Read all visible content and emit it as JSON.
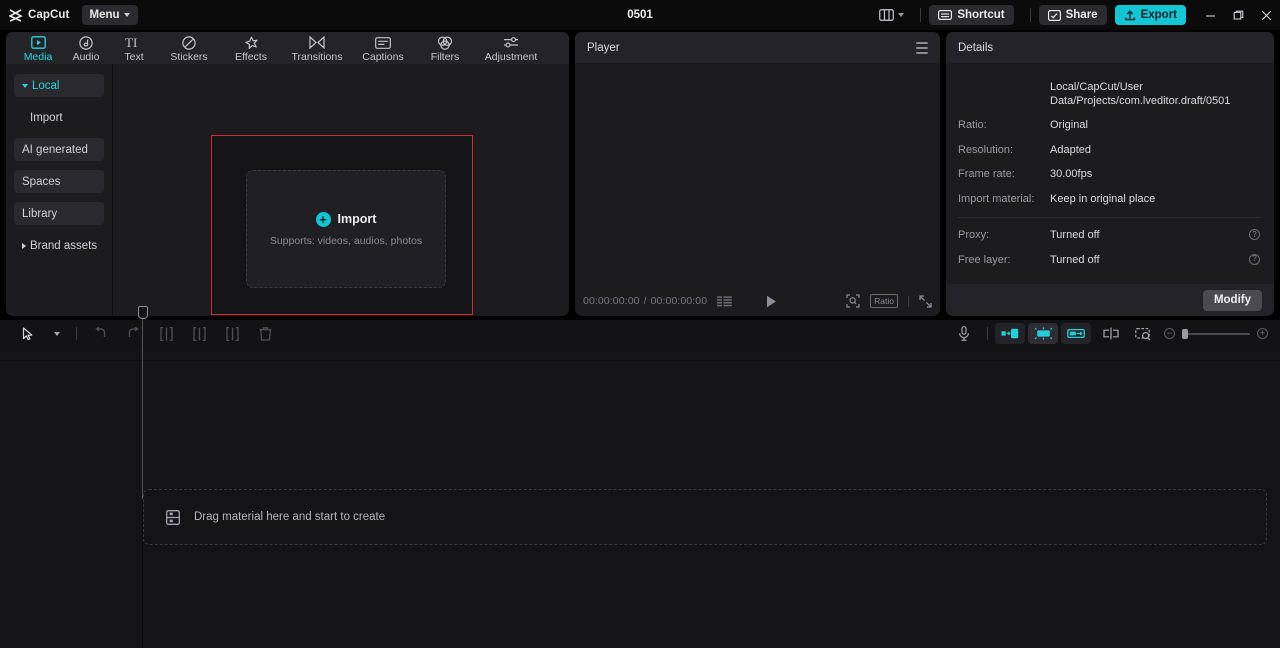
{
  "app": {
    "brand": "CapCut",
    "brand_icon": "capcut-logo-icon",
    "menu_label": "Menu",
    "project_title": "0501"
  },
  "titlebar": {
    "layout_icon": "layout-panels-icon",
    "layout_chevron_icon": "chevron-down-icon",
    "shortcut_label": "Shortcut",
    "shortcut_icon": "keyboard-icon",
    "share_label": "Share",
    "share_icon": "share-screen-icon",
    "export_label": "Export",
    "export_icon": "upload-icon",
    "minimize_icon": "minimize-icon",
    "maximize_icon": "maximize-icon",
    "close_icon": "close-icon",
    "accent_color": "#14c6d4"
  },
  "tabs": [
    {
      "label": "Media",
      "icon": "media-play-frame-icon",
      "active": true
    },
    {
      "label": "Audio",
      "icon": "audio-note-icon",
      "active": false
    },
    {
      "label": "Text",
      "icon": "text-ti-icon",
      "active": false
    },
    {
      "label": "Stickers",
      "icon": "sticker-circle-icon",
      "active": false
    },
    {
      "label": "Effects",
      "icon": "effects-sparkle-icon",
      "active": false
    },
    {
      "label": "Transitions",
      "icon": "transitions-bowtie-icon",
      "active": false
    },
    {
      "label": "Captions",
      "icon": "captions-box-icon",
      "active": false
    },
    {
      "label": "Filters",
      "icon": "filters-rings-icon",
      "active": false
    },
    {
      "label": "Adjustment",
      "icon": "adjustment-sliders-icon",
      "active": false
    }
  ],
  "sidebar": {
    "items": [
      {
        "label": "Local",
        "state": "active-expanded",
        "chevron": "chevron-down-icon"
      },
      {
        "label": "Import",
        "state": "sub",
        "chevron": ""
      },
      {
        "label": "AI generated",
        "state": "boxed",
        "chevron": ""
      },
      {
        "label": "Spaces",
        "state": "boxed",
        "chevron": ""
      },
      {
        "label": "Library",
        "state": "boxed",
        "chevron": ""
      },
      {
        "label": "Brand assets",
        "state": "collapsed",
        "chevron": "chevron-right-icon"
      }
    ]
  },
  "import_zone": {
    "plus_icon": "plus-circle-icon",
    "title": "Import",
    "subtitle": "Supports: videos, audios, photos",
    "highlight_color": "#d22d2d"
  },
  "player": {
    "title": "Player",
    "menu_icon": "hamburger-menu-icon",
    "current_time": "00:00:00:00",
    "separator": "/",
    "total_time": "00:00:00:00",
    "list_icon": "playlist-icon",
    "play_icon": "play-icon",
    "magnify_icon": "magnify-frame-icon",
    "ratio_label": "Ratio",
    "fullscreen_icon": "fullscreen-icon"
  },
  "details": {
    "title": "Details",
    "path_value": "Local/CapCut/User Data/Projects/com.lveditor.draft/0501",
    "rows": [
      {
        "label": "Ratio:",
        "value": "Original"
      },
      {
        "label": "Resolution:",
        "value": "Adapted"
      },
      {
        "label": "Frame rate:",
        "value": "30.00fps"
      },
      {
        "label": "Import material:",
        "value": "Keep in original place"
      }
    ],
    "rows_secondary": [
      {
        "label": "Proxy:",
        "value": "Turned off",
        "help_icon": "help-circle-icon",
        "help_glyph": "?"
      },
      {
        "label": "Free layer:",
        "value": "Turned off",
        "help_icon": "help-circle-icon",
        "help_glyph": "?"
      }
    ],
    "modify_label": "Modify"
  },
  "timeline": {
    "tools_left": [
      {
        "name": "select-tool",
        "icon": "cursor-arrow-icon"
      },
      {
        "name": "tool-dropdown",
        "icon": "chevron-down-icon"
      },
      {
        "name": "undo",
        "icon": "undo-icon"
      },
      {
        "name": "redo",
        "icon": "redo-icon"
      },
      {
        "name": "split",
        "icon": "split-clip-icon"
      },
      {
        "name": "trim-left",
        "icon": "trim-left-icon"
      },
      {
        "name": "trim-right",
        "icon": "trim-right-icon"
      },
      {
        "name": "delete",
        "icon": "trash-icon"
      }
    ],
    "tools_right": [
      {
        "name": "record-voiceover",
        "icon": "microphone-icon",
        "state": "normal"
      },
      {
        "name": "auto-fit-left",
        "icon": "fit-left-icon",
        "state": "teal"
      },
      {
        "name": "auto-fit-center",
        "icon": "fit-center-icon",
        "state": "teal-on"
      },
      {
        "name": "auto-fit-right",
        "icon": "fit-right-icon",
        "state": "teal"
      },
      {
        "name": "mirror-split",
        "icon": "mirror-split-icon",
        "state": "normal"
      },
      {
        "name": "preview-crop",
        "icon": "preview-crop-icon",
        "state": "normal"
      }
    ],
    "zoom_out_icon": "zoom-out-icon",
    "zoom_out_glyph": "−",
    "zoom_in_icon": "zoom-in-icon",
    "zoom_in_glyph": "+",
    "playhead_icon": "playhead-icon",
    "drag_zone": {
      "icon": "media-panel-icon",
      "text": "Drag material here and start to create"
    }
  }
}
